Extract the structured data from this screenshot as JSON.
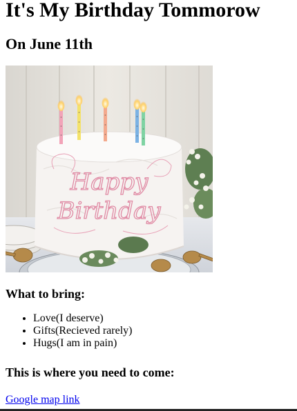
{
  "title": "It's My Birthday Tommorow",
  "date_heading": "On June 11th",
  "image": {
    "alt": "Birthday cake with candles and 'Happy Birthday' written in frosting",
    "cake_text_1": "Happy",
    "cake_text_2": "Birthday"
  },
  "bring": {
    "heading": "What to bring:",
    "items": [
      "Love(I deserve)",
      "Gifts(Recieved rarely)",
      "Hugs(I am in pain)"
    ]
  },
  "location": {
    "heading": "This is where you need to come:",
    "link_text": "Google map link"
  },
  "colors": {
    "link": "#0000ee",
    "frosting_script": "#e08aa4"
  }
}
